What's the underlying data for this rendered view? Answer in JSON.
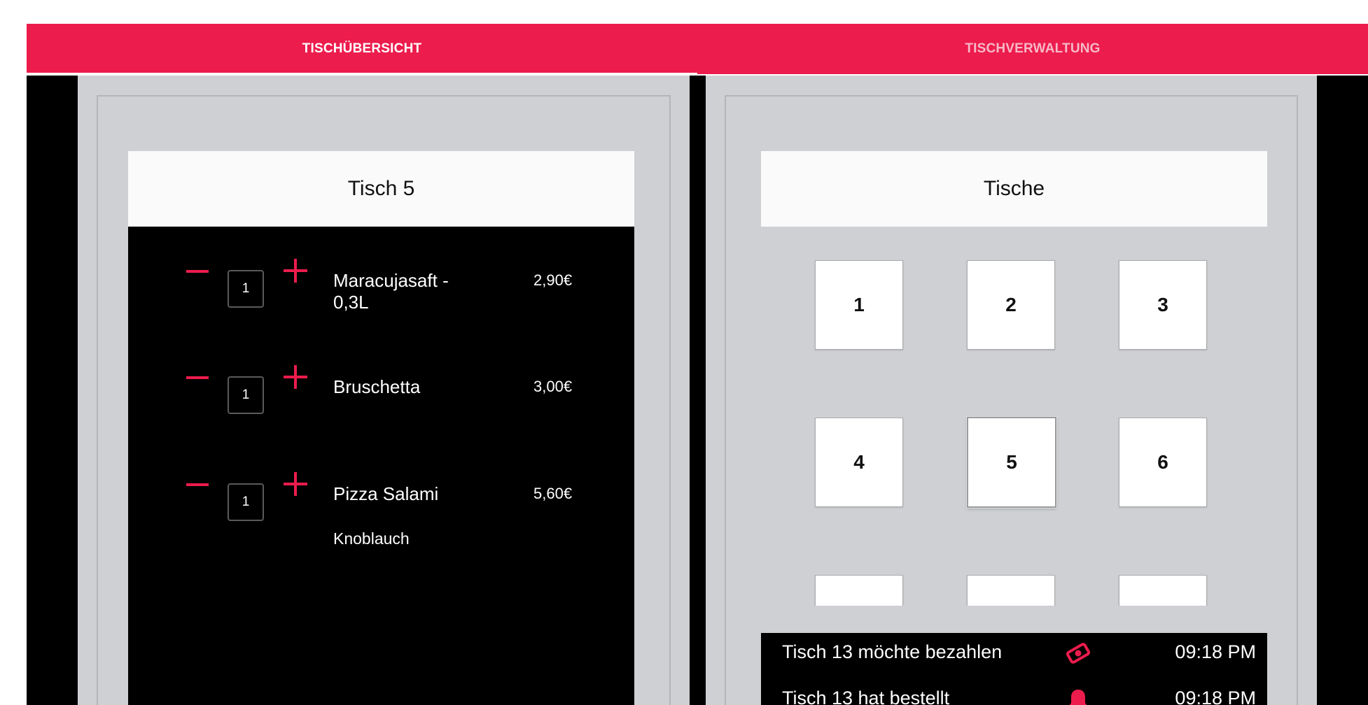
{
  "tabs": [
    {
      "label": "TISCHÜBERSICHT",
      "active": true
    },
    {
      "label": "TISCHVERWALTUNG",
      "active": false
    }
  ],
  "colors": {
    "accent": "#ec1c4c",
    "panel": "#cfd0d3",
    "background": "#000000",
    "card_header": "#fafafa"
  },
  "order_panel": {
    "title": "Tisch 5",
    "items": [
      {
        "quantity": "1",
        "name": "Maracujasaft - 0,3L",
        "price": "2,90€",
        "note": ""
      },
      {
        "quantity": "1",
        "name": "Bruschetta",
        "price": "3,00€",
        "note": ""
      },
      {
        "quantity": "1",
        "name": "Pizza Salami",
        "price": "5,60€",
        "note": "Knoblauch"
      }
    ]
  },
  "tables_panel": {
    "title": "Tische",
    "tables": [
      "1",
      "2",
      "3",
      "4",
      "5",
      "6",
      "",
      "",
      ""
    ],
    "selected_table": "5"
  },
  "notifications": [
    {
      "text": "Tisch 13 möchte bezahlen",
      "icon": "payment-icon",
      "time": "09:18 PM"
    },
    {
      "text": "Tisch 13 hat bestellt",
      "icon": "bell-icon",
      "time": "09:18 PM"
    }
  ]
}
